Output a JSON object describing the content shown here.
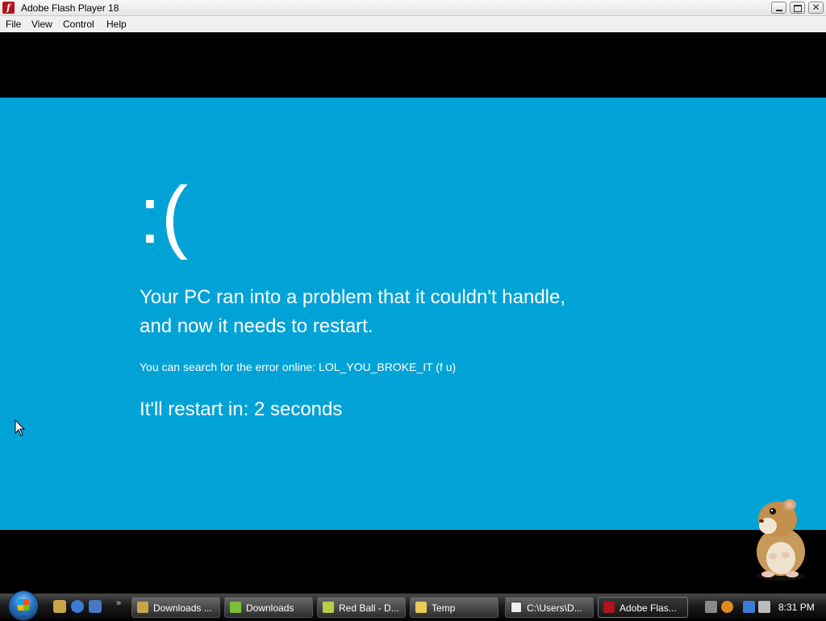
{
  "window": {
    "title": "Adobe Flash Player 18",
    "app_icon_glyph": "f",
    "controls": {
      "minimize": "minimize",
      "maximize": "maximize",
      "close": "✕"
    }
  },
  "menu": [
    "File",
    "View",
    "Control",
    "Help"
  ],
  "bsod": {
    "face": ":(",
    "line1": "Your PC ran into a problem that it couldn't handle,",
    "line2": "and now it needs to restart.",
    "search_text": "You can search for the error online: LOL_YOU_BROKE_IT (f u)",
    "restart_text": "It'll restart in: 2 seconds",
    "background_color": "#01a3d7"
  },
  "taskbar": {
    "quick_launch_more": "»",
    "tasks": [
      {
        "label": "Downloads ...",
        "icon": "folder-download-icon",
        "color": "#c9a54a"
      },
      {
        "label": "Downloads",
        "icon": "folder-icon",
        "color": "#7bbf3a"
      },
      {
        "label": "Red Ball - D...",
        "icon": "folder-icon",
        "color": "#b8cf4a"
      },
      {
        "label": "Temp",
        "icon": "folder-icon",
        "color": "#e8c85a"
      },
      {
        "label": "C:\\Users\\D...",
        "icon": "7zip-icon",
        "color": "#eeeeee"
      },
      {
        "label": "Adobe Flas...",
        "icon": "flash-icon",
        "color": "#b3131b"
      }
    ],
    "clock": "8:31 PM"
  }
}
